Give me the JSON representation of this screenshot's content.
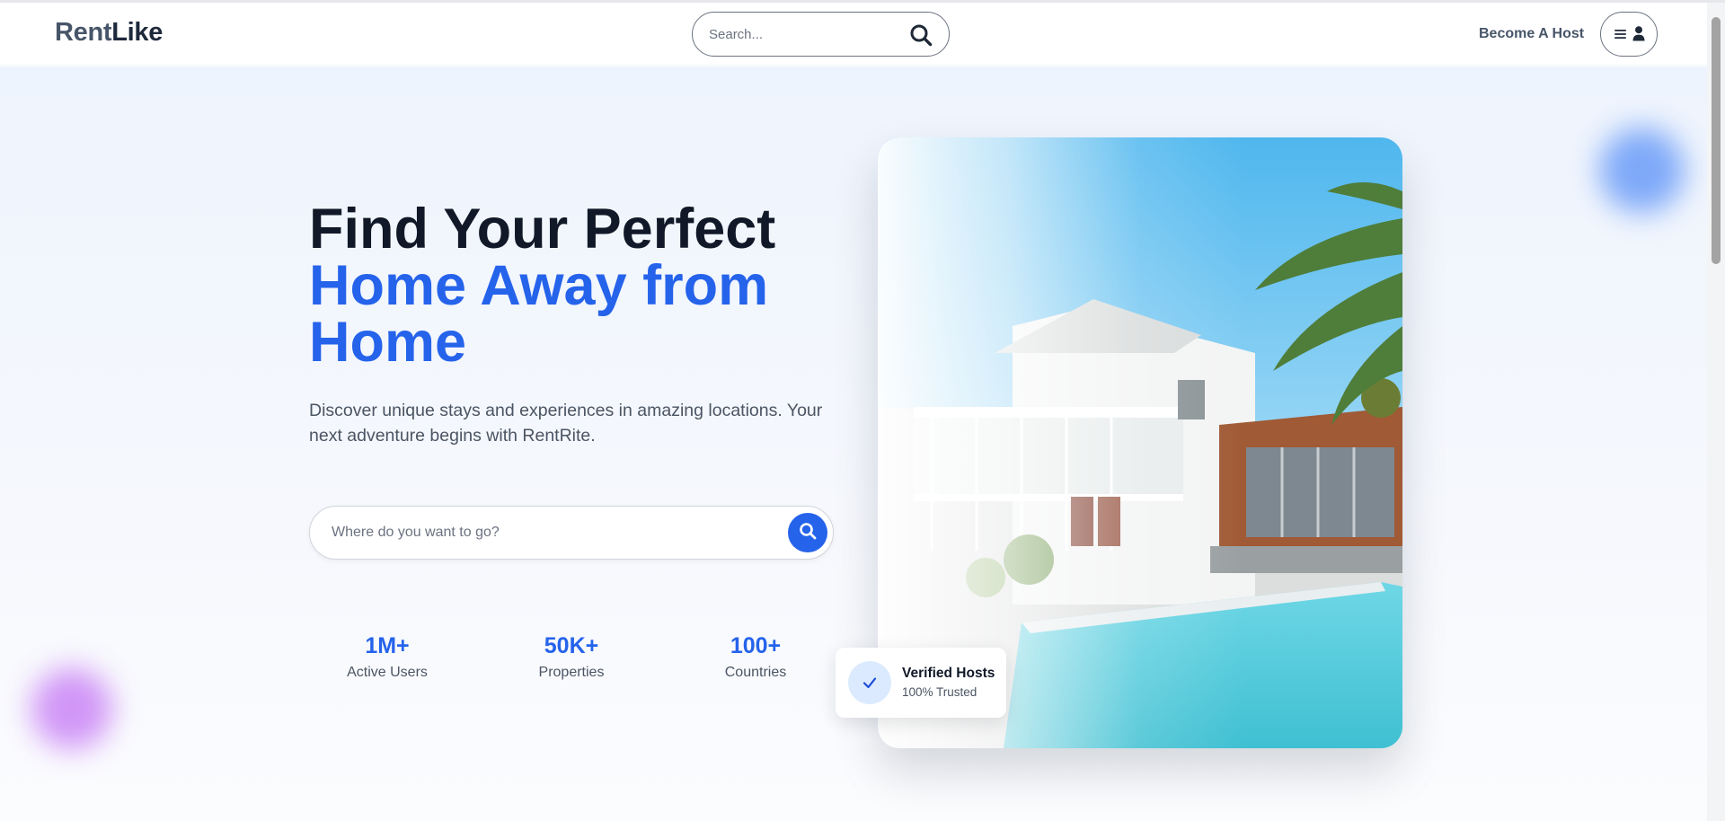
{
  "nav": {
    "logo_part1": "Rent",
    "logo_part2": "Like",
    "search_placeholder": "Search...",
    "become_host": "Become A Host"
  },
  "hero": {
    "headline_line1": "Find Your Perfect",
    "headline_line2": "Home Away from",
    "headline_line3": "Home",
    "subtext": "Discover unique stays and experiences in amazing locations. Your next adventure begins with RentRite.",
    "search_placeholder": "Where do you want to go?",
    "stats": [
      {
        "value": "1M+",
        "label": "Active Users"
      },
      {
        "value": "50K+",
        "label": "Properties"
      },
      {
        "value": "100+",
        "label": "Countries"
      }
    ],
    "badge_title": "Verified Hosts",
    "badge_subtitle": "100% Trusted"
  },
  "colors": {
    "accent": "#2563eb",
    "heading": "#111827",
    "muted_text": "#4b5563"
  },
  "icons": [
    "search-icon",
    "menu-icon",
    "user-icon",
    "check-icon"
  ]
}
